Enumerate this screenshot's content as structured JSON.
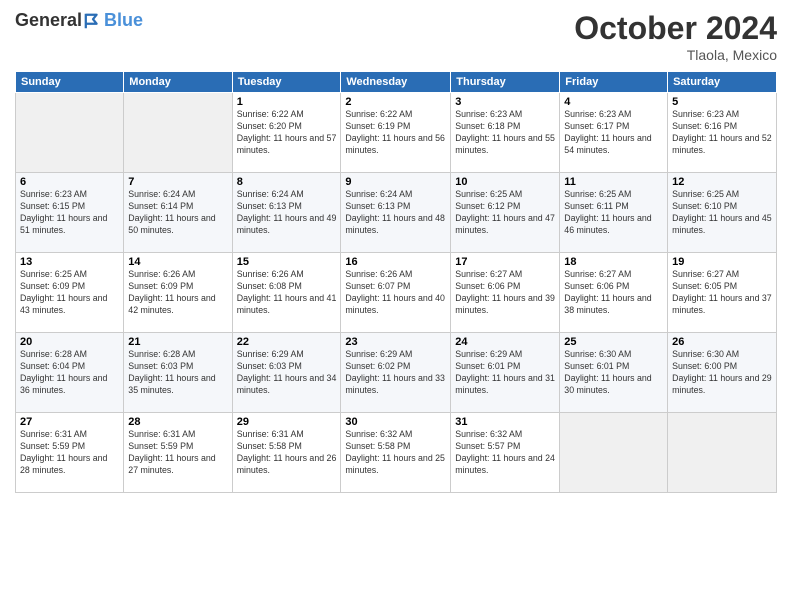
{
  "logo": {
    "general": "General",
    "blue": "Blue"
  },
  "title": "October 2024",
  "location": "Tlaola, Mexico",
  "days_header": [
    "Sunday",
    "Monday",
    "Tuesday",
    "Wednesday",
    "Thursday",
    "Friday",
    "Saturday"
  ],
  "weeks": [
    [
      {
        "day": "",
        "sunrise": "",
        "sunset": "",
        "daylight": "",
        "empty": true
      },
      {
        "day": "",
        "sunrise": "",
        "sunset": "",
        "daylight": "",
        "empty": true
      },
      {
        "day": "1",
        "sunrise": "Sunrise: 6:22 AM",
        "sunset": "Sunset: 6:20 PM",
        "daylight": "Daylight: 11 hours and 57 minutes."
      },
      {
        "day": "2",
        "sunrise": "Sunrise: 6:22 AM",
        "sunset": "Sunset: 6:19 PM",
        "daylight": "Daylight: 11 hours and 56 minutes."
      },
      {
        "day": "3",
        "sunrise": "Sunrise: 6:23 AM",
        "sunset": "Sunset: 6:18 PM",
        "daylight": "Daylight: 11 hours and 55 minutes."
      },
      {
        "day": "4",
        "sunrise": "Sunrise: 6:23 AM",
        "sunset": "Sunset: 6:17 PM",
        "daylight": "Daylight: 11 hours and 54 minutes."
      },
      {
        "day": "5",
        "sunrise": "Sunrise: 6:23 AM",
        "sunset": "Sunset: 6:16 PM",
        "daylight": "Daylight: 11 hours and 52 minutes."
      }
    ],
    [
      {
        "day": "6",
        "sunrise": "Sunrise: 6:23 AM",
        "sunset": "Sunset: 6:15 PM",
        "daylight": "Daylight: 11 hours and 51 minutes."
      },
      {
        "day": "7",
        "sunrise": "Sunrise: 6:24 AM",
        "sunset": "Sunset: 6:14 PM",
        "daylight": "Daylight: 11 hours and 50 minutes."
      },
      {
        "day": "8",
        "sunrise": "Sunrise: 6:24 AM",
        "sunset": "Sunset: 6:13 PM",
        "daylight": "Daylight: 11 hours and 49 minutes."
      },
      {
        "day": "9",
        "sunrise": "Sunrise: 6:24 AM",
        "sunset": "Sunset: 6:13 PM",
        "daylight": "Daylight: 11 hours and 48 minutes."
      },
      {
        "day": "10",
        "sunrise": "Sunrise: 6:25 AM",
        "sunset": "Sunset: 6:12 PM",
        "daylight": "Daylight: 11 hours and 47 minutes."
      },
      {
        "day": "11",
        "sunrise": "Sunrise: 6:25 AM",
        "sunset": "Sunset: 6:11 PM",
        "daylight": "Daylight: 11 hours and 46 minutes."
      },
      {
        "day": "12",
        "sunrise": "Sunrise: 6:25 AM",
        "sunset": "Sunset: 6:10 PM",
        "daylight": "Daylight: 11 hours and 45 minutes."
      }
    ],
    [
      {
        "day": "13",
        "sunrise": "Sunrise: 6:25 AM",
        "sunset": "Sunset: 6:09 PM",
        "daylight": "Daylight: 11 hours and 43 minutes."
      },
      {
        "day": "14",
        "sunrise": "Sunrise: 6:26 AM",
        "sunset": "Sunset: 6:09 PM",
        "daylight": "Daylight: 11 hours and 42 minutes."
      },
      {
        "day": "15",
        "sunrise": "Sunrise: 6:26 AM",
        "sunset": "Sunset: 6:08 PM",
        "daylight": "Daylight: 11 hours and 41 minutes."
      },
      {
        "day": "16",
        "sunrise": "Sunrise: 6:26 AM",
        "sunset": "Sunset: 6:07 PM",
        "daylight": "Daylight: 11 hours and 40 minutes."
      },
      {
        "day": "17",
        "sunrise": "Sunrise: 6:27 AM",
        "sunset": "Sunset: 6:06 PM",
        "daylight": "Daylight: 11 hours and 39 minutes."
      },
      {
        "day": "18",
        "sunrise": "Sunrise: 6:27 AM",
        "sunset": "Sunset: 6:06 PM",
        "daylight": "Daylight: 11 hours and 38 minutes."
      },
      {
        "day": "19",
        "sunrise": "Sunrise: 6:27 AM",
        "sunset": "Sunset: 6:05 PM",
        "daylight": "Daylight: 11 hours and 37 minutes."
      }
    ],
    [
      {
        "day": "20",
        "sunrise": "Sunrise: 6:28 AM",
        "sunset": "Sunset: 6:04 PM",
        "daylight": "Daylight: 11 hours and 36 minutes."
      },
      {
        "day": "21",
        "sunrise": "Sunrise: 6:28 AM",
        "sunset": "Sunset: 6:03 PM",
        "daylight": "Daylight: 11 hours and 35 minutes."
      },
      {
        "day": "22",
        "sunrise": "Sunrise: 6:29 AM",
        "sunset": "Sunset: 6:03 PM",
        "daylight": "Daylight: 11 hours and 34 minutes."
      },
      {
        "day": "23",
        "sunrise": "Sunrise: 6:29 AM",
        "sunset": "Sunset: 6:02 PM",
        "daylight": "Daylight: 11 hours and 33 minutes."
      },
      {
        "day": "24",
        "sunrise": "Sunrise: 6:29 AM",
        "sunset": "Sunset: 6:01 PM",
        "daylight": "Daylight: 11 hours and 31 minutes."
      },
      {
        "day": "25",
        "sunrise": "Sunrise: 6:30 AM",
        "sunset": "Sunset: 6:01 PM",
        "daylight": "Daylight: 11 hours and 30 minutes."
      },
      {
        "day": "26",
        "sunrise": "Sunrise: 6:30 AM",
        "sunset": "Sunset: 6:00 PM",
        "daylight": "Daylight: 11 hours and 29 minutes."
      }
    ],
    [
      {
        "day": "27",
        "sunrise": "Sunrise: 6:31 AM",
        "sunset": "Sunset: 5:59 PM",
        "daylight": "Daylight: 11 hours and 28 minutes."
      },
      {
        "day": "28",
        "sunrise": "Sunrise: 6:31 AM",
        "sunset": "Sunset: 5:59 PM",
        "daylight": "Daylight: 11 hours and 27 minutes."
      },
      {
        "day": "29",
        "sunrise": "Sunrise: 6:31 AM",
        "sunset": "Sunset: 5:58 PM",
        "daylight": "Daylight: 11 hours and 26 minutes."
      },
      {
        "day": "30",
        "sunrise": "Sunrise: 6:32 AM",
        "sunset": "Sunset: 5:58 PM",
        "daylight": "Daylight: 11 hours and 25 minutes."
      },
      {
        "day": "31",
        "sunrise": "Sunrise: 6:32 AM",
        "sunset": "Sunset: 5:57 PM",
        "daylight": "Daylight: 11 hours and 24 minutes."
      },
      {
        "day": "",
        "sunrise": "",
        "sunset": "",
        "daylight": "",
        "empty": true
      },
      {
        "day": "",
        "sunrise": "",
        "sunset": "",
        "daylight": "",
        "empty": true
      }
    ]
  ]
}
